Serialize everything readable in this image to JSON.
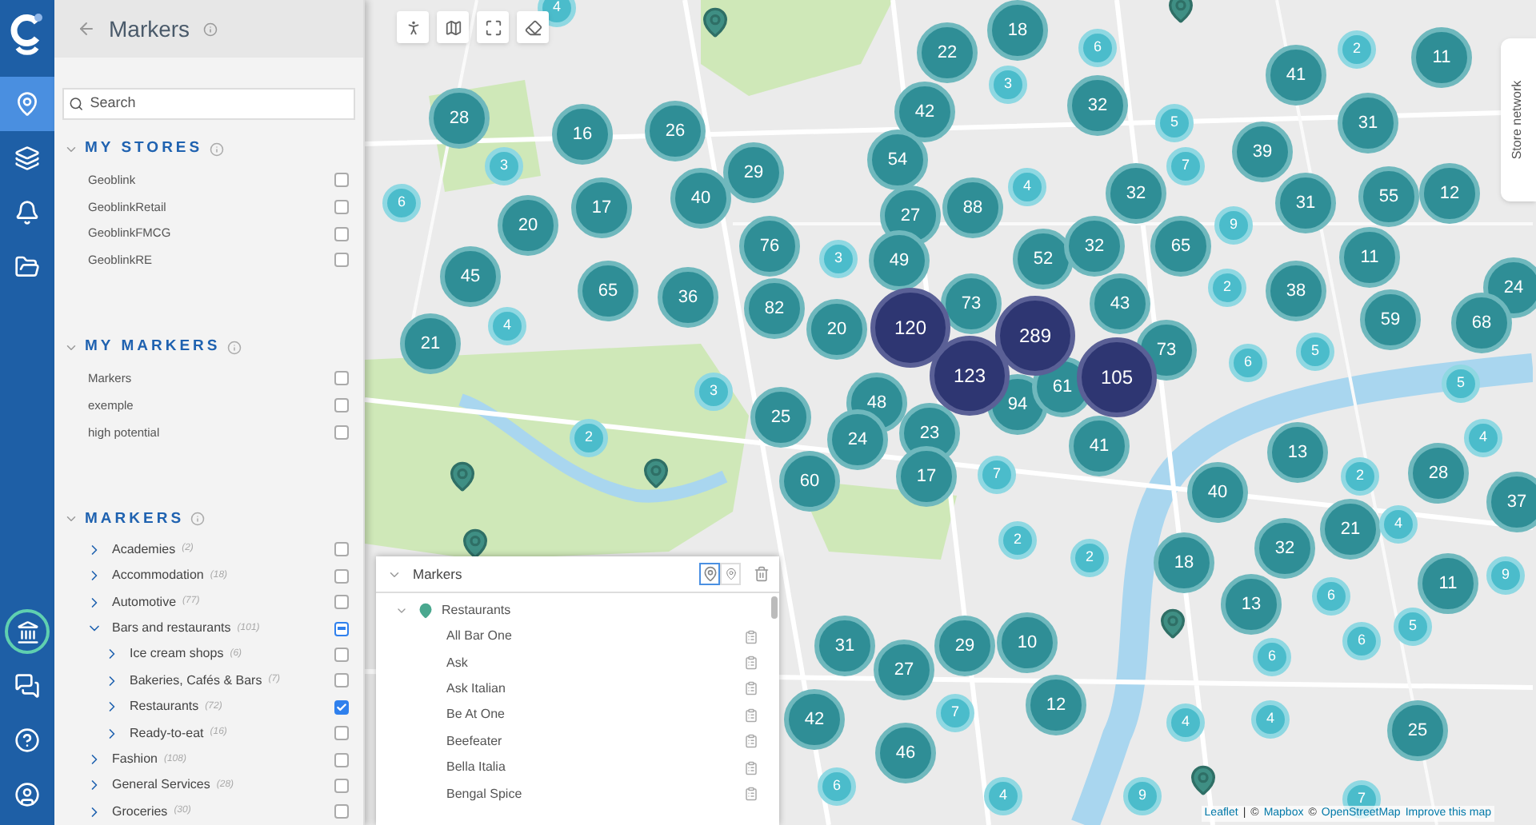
{
  "rail": {
    "items": [
      {
        "kind": "pin",
        "selected": true
      },
      {
        "kind": "layers",
        "selected": false
      },
      {
        "kind": "bell",
        "selected": false
      },
      {
        "kind": "folder",
        "selected": false
      }
    ],
    "bottom_items": [
      {
        "kind": "bank",
        "selected": false
      },
      {
        "kind": "chat",
        "selected": false
      },
      {
        "kind": "help",
        "selected": false
      },
      {
        "kind": "user",
        "selected": false
      }
    ]
  },
  "panel": {
    "title": "Markers",
    "search": {
      "placeholder": "Search"
    },
    "sections": [
      {
        "title": "MY STORES",
        "expanded": true,
        "items": [
          {
            "label": "Geoblink",
            "checked": false
          },
          {
            "label": "GeoblinkRetail",
            "checked": false
          },
          {
            "label": "GeoblinkFMCG",
            "checked": false
          },
          {
            "label": "GeoblinkRE",
            "checked": false
          }
        ]
      },
      {
        "title": "MY MARKERS",
        "expanded": true,
        "items": [
          {
            "label": "Markers",
            "checked": false
          },
          {
            "label": "exemple",
            "checked": false
          },
          {
            "label": "high potential",
            "checked": false
          }
        ]
      }
    ],
    "markers": {
      "title": "MARKERS",
      "expanded": true,
      "categories": [
        {
          "label": "Academies",
          "count": "(2)",
          "expanded": false,
          "checked": false,
          "indeterminate": false
        },
        {
          "label": "Accommodation",
          "count": "(18)",
          "expanded": false,
          "checked": false,
          "indeterminate": false
        },
        {
          "label": "Automotive",
          "count": "(77)",
          "expanded": false,
          "checked": false,
          "indeterminate": false
        },
        {
          "label": "Bars and restaurants",
          "count": "(101)",
          "expanded": true,
          "checked": false,
          "indeterminate": true,
          "children": [
            {
              "label": "Ice cream shops",
              "count": "(6)",
              "expanded": false,
              "checked": false,
              "indeterminate": false
            },
            {
              "label": "Bakeries, Cafés & Bars",
              "count": "(7)",
              "expanded": false,
              "checked": false,
              "indeterminate": false
            },
            {
              "label": "Restaurants",
              "count": "(72)",
              "expanded": false,
              "checked": true,
              "indeterminate": false
            },
            {
              "label": "Ready-to-eat",
              "count": "(16)",
              "expanded": false,
              "checked": false,
              "indeterminate": false
            }
          ]
        },
        {
          "label": "Fashion",
          "count": "(108)",
          "expanded": false,
          "checked": false,
          "indeterminate": false
        },
        {
          "label": "General Services",
          "count": "(28)",
          "expanded": false,
          "checked": false,
          "indeterminate": false
        },
        {
          "label": "Groceries",
          "count": "(30)",
          "expanded": false,
          "checked": false,
          "indeterminate": false
        }
      ]
    }
  },
  "map": {
    "toolbar": [
      {
        "kind": "person"
      },
      {
        "kind": "map"
      },
      {
        "kind": "fullscreen"
      },
      {
        "kind": "eraser"
      }
    ],
    "clusters": [
      {
        "label": "4",
        "kind": "small"
      },
      {
        "label": "22",
        "kind": "medium"
      },
      {
        "label": "18",
        "kind": "medium"
      },
      {
        "label": "6",
        "kind": "small"
      },
      {
        "label": "3",
        "kind": "small"
      },
      {
        "label": "41",
        "kind": "medium"
      },
      {
        "label": "2",
        "kind": "small"
      },
      {
        "label": "11",
        "kind": "medium"
      },
      {
        "label": "32",
        "kind": "medium"
      },
      {
        "label": "5",
        "kind": "small"
      },
      {
        "label": "42",
        "kind": "medium"
      },
      {
        "label": "28",
        "kind": "medium"
      },
      {
        "label": "16",
        "kind": "medium"
      },
      {
        "label": "26",
        "kind": "medium"
      },
      {
        "label": "3",
        "kind": "small"
      },
      {
        "label": "54",
        "kind": "medium"
      },
      {
        "label": "39",
        "kind": "medium"
      },
      {
        "label": "31",
        "kind": "medium"
      },
      {
        "label": "29",
        "kind": "medium"
      },
      {
        "label": "7",
        "kind": "small"
      },
      {
        "label": "6",
        "kind": "small"
      },
      {
        "label": "20",
        "kind": "medium"
      },
      {
        "label": "17",
        "kind": "medium"
      },
      {
        "label": "40",
        "kind": "medium"
      },
      {
        "label": "27",
        "kind": "medium"
      },
      {
        "label": "88",
        "kind": "medium"
      },
      {
        "label": "4",
        "kind": "small"
      },
      {
        "label": "32",
        "kind": "medium"
      },
      {
        "label": "31",
        "kind": "medium"
      },
      {
        "label": "55",
        "kind": "medium"
      },
      {
        "label": "12",
        "kind": "medium"
      },
      {
        "label": "76",
        "kind": "medium"
      },
      {
        "label": "3",
        "kind": "small"
      },
      {
        "label": "49",
        "kind": "medium"
      },
      {
        "label": "52",
        "kind": "medium"
      },
      {
        "label": "32",
        "kind": "medium"
      },
      {
        "label": "65",
        "kind": "medium"
      },
      {
        "label": "9",
        "kind": "small"
      },
      {
        "label": "11",
        "kind": "medium"
      },
      {
        "label": "45",
        "kind": "medium"
      },
      {
        "label": "65",
        "kind": "medium"
      },
      {
        "label": "36",
        "kind": "medium"
      },
      {
        "label": "82",
        "kind": "medium"
      },
      {
        "label": "73",
        "kind": "medium"
      },
      {
        "label": "43",
        "kind": "medium"
      },
      {
        "label": "2",
        "kind": "small"
      },
      {
        "label": "38",
        "kind": "medium"
      },
      {
        "label": "24",
        "kind": "medium"
      },
      {
        "label": "21",
        "kind": "medium"
      },
      {
        "label": "4",
        "kind": "small"
      },
      {
        "label": "20",
        "kind": "medium"
      },
      {
        "label": "59",
        "kind": "medium"
      },
      {
        "label": "68",
        "kind": "medium"
      },
      {
        "label": "73",
        "kind": "medium"
      },
      {
        "label": "94",
        "kind": "medium"
      },
      {
        "label": "61",
        "kind": "medium"
      },
      {
        "label": "5",
        "kind": "small"
      },
      {
        "label": "6",
        "kind": "small"
      },
      {
        "label": "3",
        "kind": "small"
      },
      {
        "label": "48",
        "kind": "medium"
      },
      {
        "label": "25",
        "kind": "medium"
      },
      {
        "label": "5",
        "kind": "small"
      },
      {
        "label": "24",
        "kind": "medium"
      },
      {
        "label": "23",
        "kind": "medium"
      },
      {
        "label": "41",
        "kind": "medium"
      },
      {
        "label": "2",
        "kind": "small"
      },
      {
        "label": "13",
        "kind": "medium"
      },
      {
        "label": "4",
        "kind": "small"
      },
      {
        "label": "60",
        "kind": "medium"
      },
      {
        "label": "17",
        "kind": "medium"
      },
      {
        "label": "7",
        "kind": "small"
      },
      {
        "label": "2",
        "kind": "small"
      },
      {
        "label": "28",
        "kind": "medium"
      },
      {
        "label": "40",
        "kind": "medium"
      },
      {
        "label": "37",
        "kind": "medium"
      },
      {
        "label": "21",
        "kind": "medium"
      },
      {
        "label": "4",
        "kind": "small"
      },
      {
        "label": "2",
        "kind": "small"
      },
      {
        "label": "32",
        "kind": "medium"
      },
      {
        "label": "18",
        "kind": "medium"
      },
      {
        "label": "2",
        "kind": "small"
      },
      {
        "label": "9",
        "kind": "small"
      },
      {
        "label": "11",
        "kind": "medium"
      },
      {
        "label": "13",
        "kind": "medium"
      },
      {
        "label": "6",
        "kind": "small"
      },
      {
        "label": "5",
        "kind": "small"
      },
      {
        "label": "6",
        "kind": "small"
      },
      {
        "label": "31",
        "kind": "medium"
      },
      {
        "label": "27",
        "kind": "medium"
      },
      {
        "label": "29",
        "kind": "medium"
      },
      {
        "label": "10",
        "kind": "medium"
      },
      {
        "label": "6",
        "kind": "small"
      },
      {
        "label": "7",
        "kind": "small"
      },
      {
        "label": "12",
        "kind": "medium"
      },
      {
        "label": "42",
        "kind": "medium"
      },
      {
        "label": "4",
        "kind": "small"
      },
      {
        "label": "4",
        "kind": "small"
      },
      {
        "label": "25",
        "kind": "medium"
      },
      {
        "label": "46",
        "kind": "medium"
      },
      {
        "label": "6",
        "kind": "small"
      },
      {
        "label": "4",
        "kind": "small"
      },
      {
        "label": "9",
        "kind": "small"
      },
      {
        "label": "7",
        "kind": "small"
      },
      {
        "label": "120",
        "kind": "large"
      },
      {
        "label": "289",
        "kind": "large"
      },
      {
        "label": "123",
        "kind": "large"
      },
      {
        "label": "105",
        "kind": "large"
      }
    ],
    "side_tab": "Store network",
    "attribution": [
      {
        "kind": "link",
        "text": "Leaflet"
      },
      {
        "kind": "text",
        "text": "|"
      },
      {
        "kind": "text",
        "text": "©"
      },
      {
        "kind": "link",
        "text": "Mapbox"
      },
      {
        "kind": "text",
        "text": "©"
      },
      {
        "kind": "link",
        "text": "OpenStreetMap"
      },
      {
        "kind": "link",
        "text": "Improve this map"
      }
    ]
  },
  "markers_panel": {
    "title": "Markers",
    "expanded": true,
    "modes": [
      {
        "kind": "pin",
        "selected": true
      },
      {
        "kind": "thin-pin",
        "selected": false
      }
    ],
    "groups": [
      {
        "label": "Restaurants",
        "expanded": true,
        "items": [
          "All Bar One",
          "Ask",
          "Ask Italian",
          "Be At One",
          "Beefeater",
          "Bella Italia",
          "Bengal Spice"
        ]
      }
    ]
  }
}
